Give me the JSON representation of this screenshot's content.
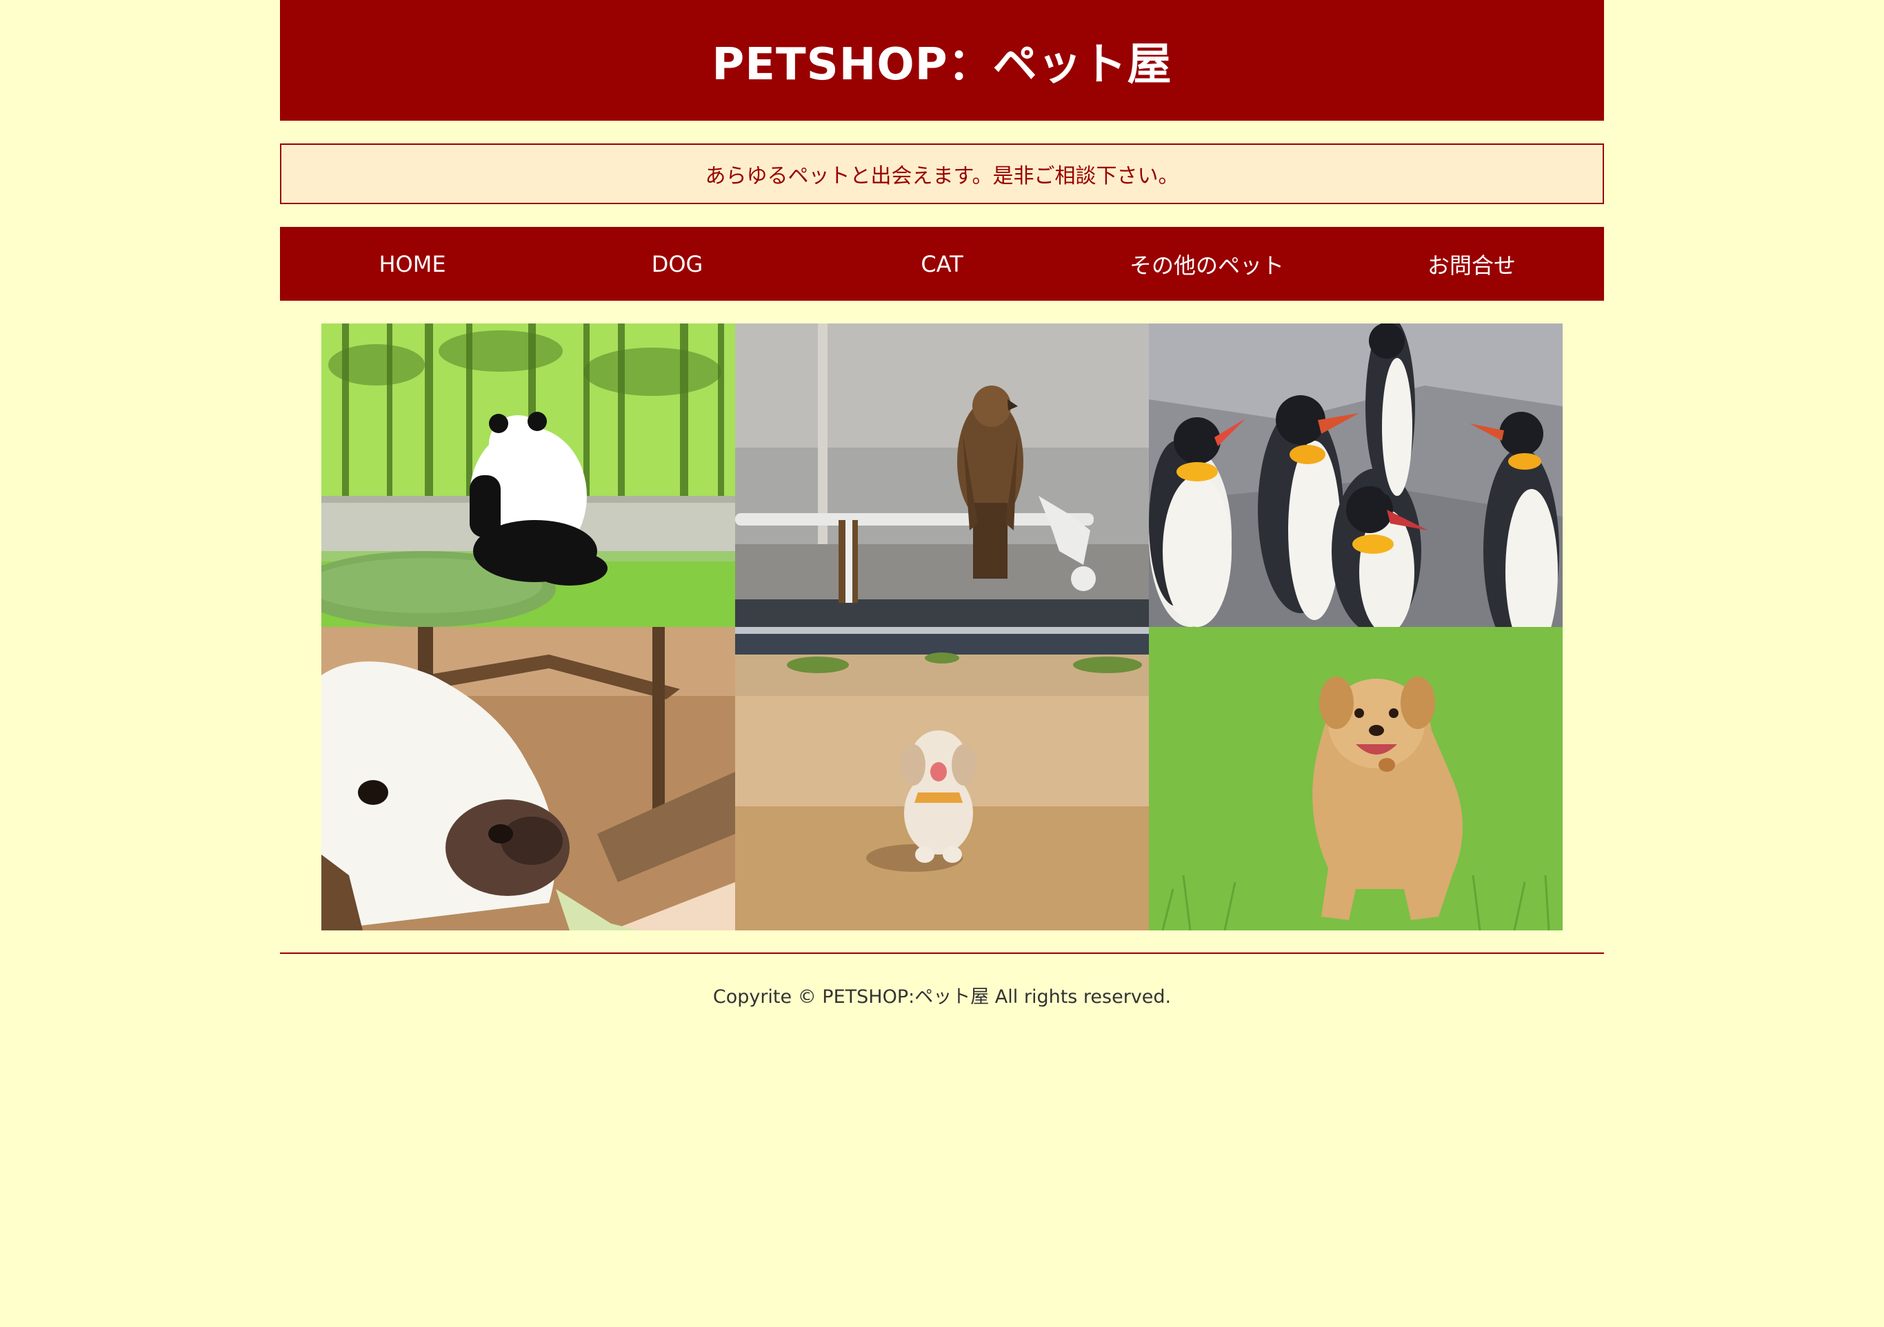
{
  "header": {
    "title": "PETSHOP：ペット屋"
  },
  "tagline": "あらゆるペットと出会えます。是非ご相談下さい。",
  "nav": {
    "items": [
      {
        "label": "HOME"
      },
      {
        "label": "DOG"
      },
      {
        "label": "CAT"
      },
      {
        "label": "その他のペット"
      },
      {
        "label": "お問合せ"
      }
    ]
  },
  "gallery": {
    "photos": [
      {
        "subject": "panda"
      },
      {
        "subject": "hawk"
      },
      {
        "subject": "penguins"
      },
      {
        "subject": "alpaca"
      },
      {
        "subject": "poodle"
      },
      {
        "subject": "golden-retriever"
      }
    ]
  },
  "footer": {
    "copyright": "Copyrite © PETSHOP:ペット屋 All rights reserved."
  },
  "colors": {
    "page_background": "#ffffcc",
    "brand": "#990000",
    "tagline_background": "#ffeecc"
  }
}
